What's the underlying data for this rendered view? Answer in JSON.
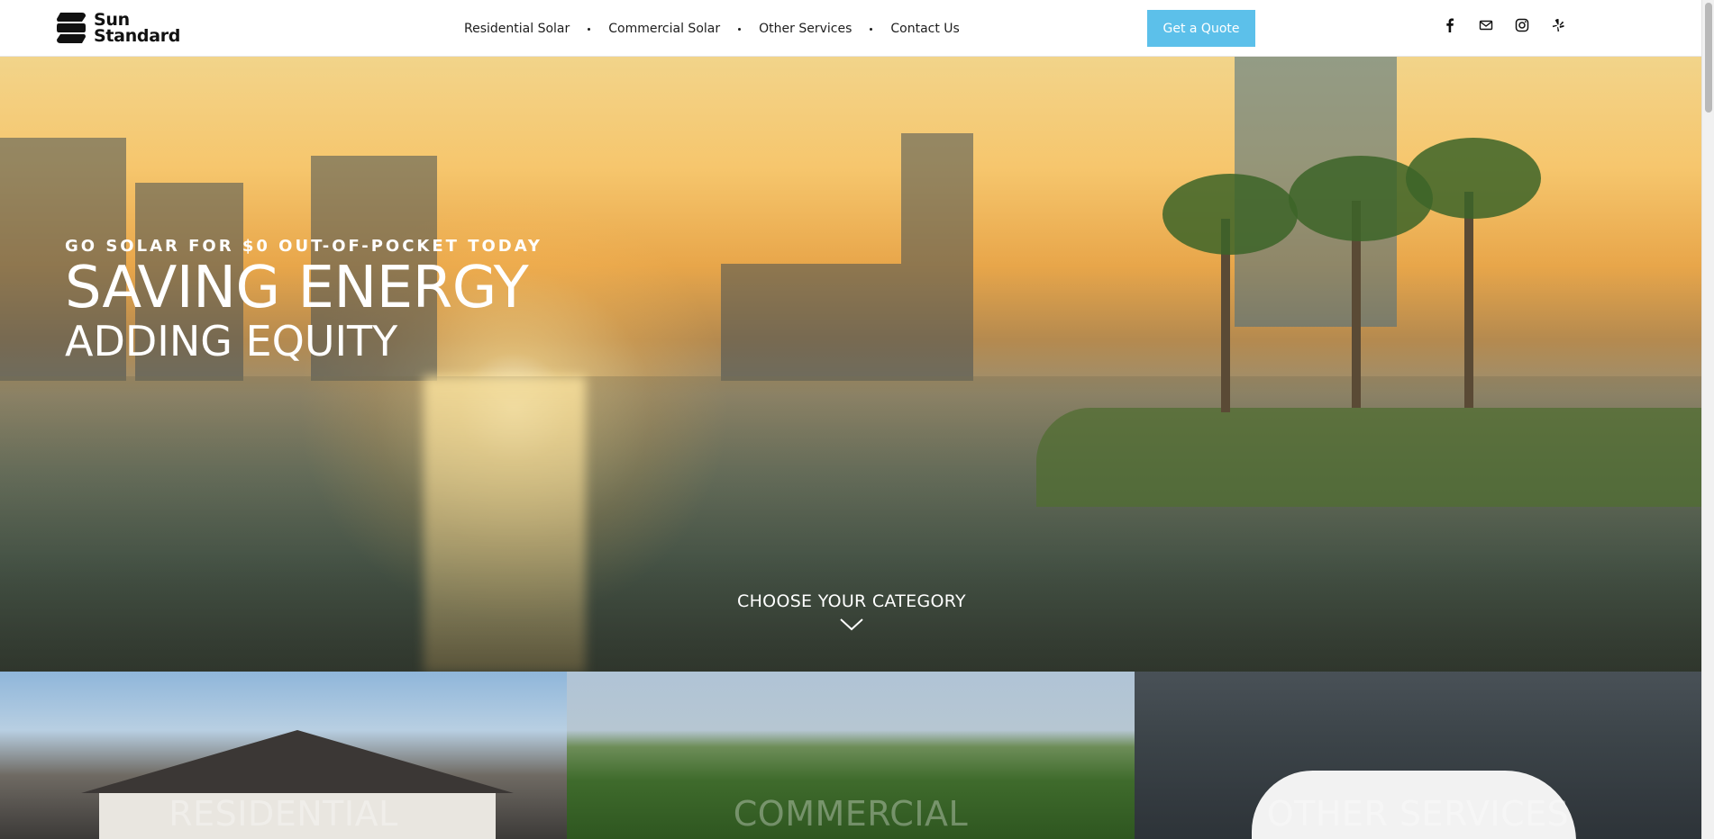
{
  "brand": {
    "name_line1": "Sun",
    "name_line2": "Standard"
  },
  "nav": {
    "items": [
      {
        "label": "Residential Solar"
      },
      {
        "label": "Commercial Solar"
      },
      {
        "label": "Other Services"
      },
      {
        "label": "Contact Us"
      }
    ]
  },
  "header": {
    "quote_button": "Get a Quote"
  },
  "socials": [
    "facebook-icon",
    "email-icon",
    "instagram-icon",
    "yelp-icon"
  ],
  "hero": {
    "kicker": "GO SOLAR FOR $0 OUT-OF-POCKET TODAY",
    "title": "SAVING ENERGY",
    "subtitle": "ADDING EQUITY",
    "choose": "CHOOSE YOUR CATEGORY"
  },
  "categories": [
    {
      "label": "RESIDENTIAL"
    },
    {
      "label": "COMMERCIAL"
    },
    {
      "label": "OTHER SERVICES"
    }
  ],
  "colors": {
    "accent": "#5cc0ea",
    "text": "#1d1d1d",
    "hero_text": "#ffffff"
  }
}
